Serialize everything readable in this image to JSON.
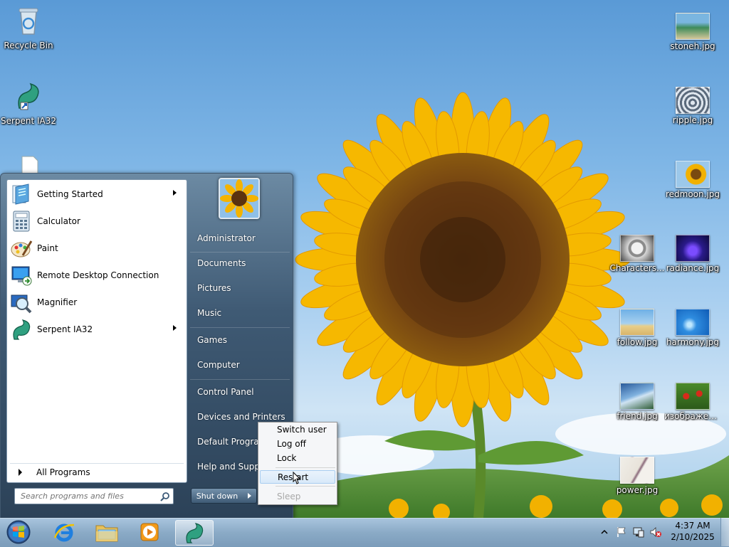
{
  "desktop": {
    "left_icons": [
      {
        "label": "Recycle Bin",
        "icon": "recycle-bin-icon"
      },
      {
        "label": "Serpent IA32",
        "icon": "serpent-icon"
      }
    ],
    "right_icons": [
      {
        "label": "stoneh.jpg"
      },
      {
        "label": "ripple.jpg"
      },
      {
        "label": "redmoon.jpg"
      },
      {
        "label": "Characters..."
      },
      {
        "label": "radiance.jpg"
      },
      {
        "label": "follow.jpg"
      },
      {
        "label": "harmony.jpg"
      },
      {
        "label": "friend.jpg"
      },
      {
        "label": "изображен..."
      },
      {
        "label": "power.jpg"
      }
    ]
  },
  "start_menu": {
    "programs": [
      {
        "label": "Getting Started",
        "icon": "getting-started-icon",
        "submenu": true
      },
      {
        "label": "Calculator",
        "icon": "calculator-icon",
        "submenu": false
      },
      {
        "label": "Paint",
        "icon": "paint-icon",
        "submenu": false
      },
      {
        "label": "Remote Desktop Connection",
        "icon": "remote-desktop-icon",
        "submenu": false
      },
      {
        "label": "Magnifier",
        "icon": "magnifier-icon",
        "submenu": false
      },
      {
        "label": "Serpent IA32",
        "icon": "serpent-icon",
        "submenu": true
      }
    ],
    "all_programs": "All Programs",
    "search_placeholder": "Search programs and files",
    "places": [
      "Administrator",
      "Documents",
      "Pictures",
      "Music",
      "Games",
      "Computer",
      "Control Panel",
      "Devices and Printers",
      "Default Programs",
      "Help and Support"
    ],
    "shutdown_label": "Shut down"
  },
  "power_menu": {
    "items": [
      {
        "label": "Switch user",
        "state": "normal"
      },
      {
        "label": "Log off",
        "state": "normal"
      },
      {
        "label": "Lock",
        "state": "normal"
      },
      {
        "label": "Restart",
        "state": "hover"
      },
      {
        "label": "Sleep",
        "state": "disabled"
      }
    ]
  },
  "taskbar": {
    "clock_time": "4:37 AM",
    "clock_date": "2/10/2025",
    "pinned": [
      "internet-explorer-icon",
      "windows-explorer-icon",
      "media-player-icon",
      "serpent-icon"
    ]
  },
  "colors": {
    "petal": "#f6b800",
    "sky": "#7fb6e6",
    "menu_dark": "#3f5a74"
  }
}
